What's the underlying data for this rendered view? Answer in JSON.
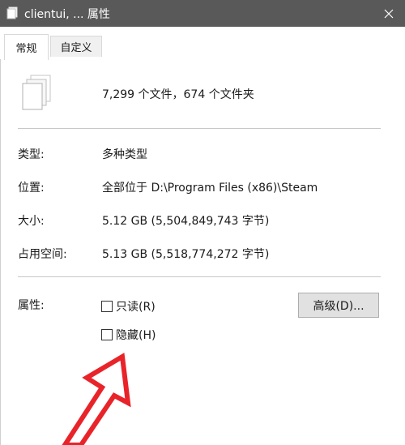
{
  "window": {
    "title": "clientui, ... 属性",
    "title_icon": "files-icon",
    "close_icon": "close-icon"
  },
  "tabs": [
    {
      "label": "常规",
      "active": true
    },
    {
      "label": "自定义",
      "active": false
    }
  ],
  "general": {
    "summary": "7,299 个文件，674 个文件夹",
    "rows": [
      {
        "label": "类型:",
        "value": "多种类型"
      },
      {
        "label": "位置:",
        "value": "全部位于 D:\\Program Files (x86)\\Steam"
      },
      {
        "label": "大小:",
        "value": "5.12 GB (5,504,849,743 字节)"
      },
      {
        "label": "占用空间:",
        "value": "5.13 GB (5,518,774,272 字节)"
      }
    ],
    "attributes_label": "属性:",
    "readonly_label": "只读(R)",
    "readonly_checked": false,
    "hidden_label": "隐藏(H)",
    "hidden_checked": false,
    "advanced_button": "高级(D)..."
  },
  "colors": {
    "titlebar": "#595959",
    "arrow": "#e8242a"
  }
}
